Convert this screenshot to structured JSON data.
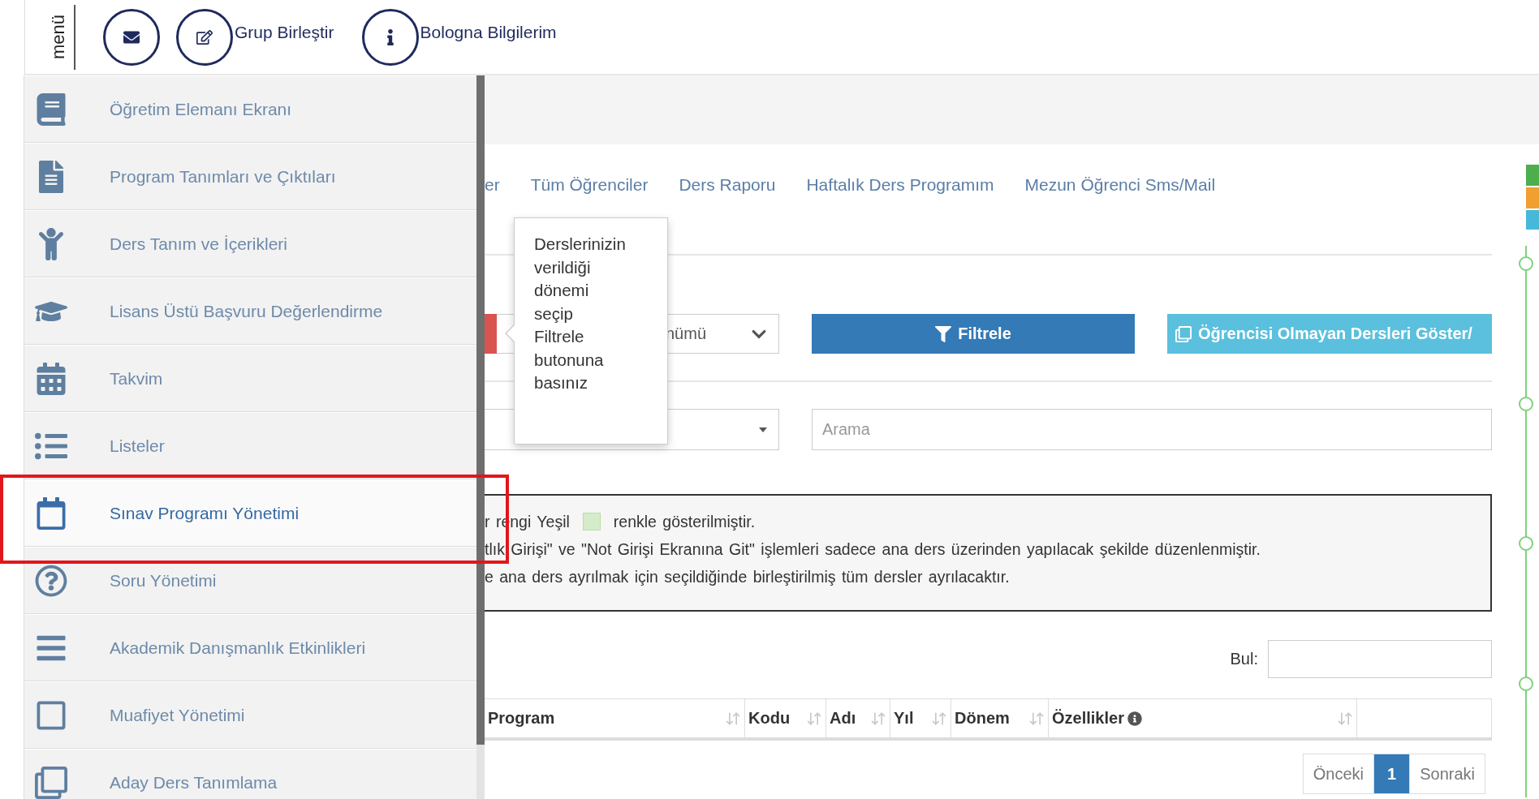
{
  "top_bar": {
    "menu_label": "menü",
    "actions": [
      {
        "kind": "icon"
      },
      {
        "kind": "labeled",
        "label": "Grup Birleştir"
      },
      {
        "kind": "labeled",
        "label": "Bologna Bilgilerim"
      }
    ]
  },
  "sidebar": {
    "items": [
      {
        "label": "Öğretim Elemanı Ekranı",
        "selected": false
      },
      {
        "label": "Program Tanımları ve Çıktıları",
        "selected": false
      },
      {
        "label": "Ders Tanım ve İçerikleri",
        "selected": false
      },
      {
        "label": "Lisans Üstü Başvuru Değerlendirme",
        "selected": false
      },
      {
        "label": "Takvim",
        "selected": false
      },
      {
        "label": "Listeler",
        "selected": false
      },
      {
        "label": "Sınav Programı Yönetimi",
        "selected": true
      },
      {
        "label": "Soru Yönetimi",
        "selected": false
      },
      {
        "label": "Akademik Danışmanlık Etkinlikleri",
        "selected": false
      },
      {
        "label": "Muafiyet Yönetimi",
        "selected": false
      },
      {
        "label": "Aday Ders Tanımlama",
        "selected": false
      }
    ]
  },
  "nav_links": [
    "er",
    "Tüm Öğrenciler",
    "Ders Raporu",
    "Haftalık Ders Programım",
    "Mezun Öğrenci Sms/Mail"
  ],
  "tooltip": "Derslerinizin verildiği dönemi seçip Filtrele butonuna basınız",
  "filters": {
    "term_select": "nümü",
    "filter_button": "Filtrele",
    "show_button": "Öğrencisi Olmayan Dersleri Göster/",
    "search_placeholder": "Arama"
  },
  "notice": {
    "lines": [
      {
        "kind": "swatch",
        "before": "r rengi Yeşil",
        "after": "renkle gösterilmiştir."
      },
      {
        "kind": "text",
        "text": "tlık Girişi\" ve \"Not Girişi Ekranına Git\" işlemleri sadece ana ders üzerinden yapılacak şekilde düzenlenmiştir."
      },
      {
        "kind": "text",
        "text": "e ana ders ayrılmak için seçildiğinde birleştirilmiş tüm dersler ayrılacaktır."
      }
    ]
  },
  "table": {
    "search_label": "Bul:",
    "columns": [
      {
        "label": "Program",
        "kind": "sortable"
      },
      {
        "label": "Kodu",
        "kind": "sortable"
      },
      {
        "label": "Adı",
        "kind": "sortable"
      },
      {
        "label": "Yıl",
        "kind": "sortable"
      },
      {
        "label": "Dönem",
        "kind": "sortable"
      },
      {
        "label": "Özellikler",
        "kind": "info"
      }
    ]
  },
  "pagination": [
    {
      "label": "Önceki",
      "selected": false
    },
    {
      "label": "1",
      "selected": true
    },
    {
      "label": "Sonraki",
      "selected": false
    }
  ]
}
